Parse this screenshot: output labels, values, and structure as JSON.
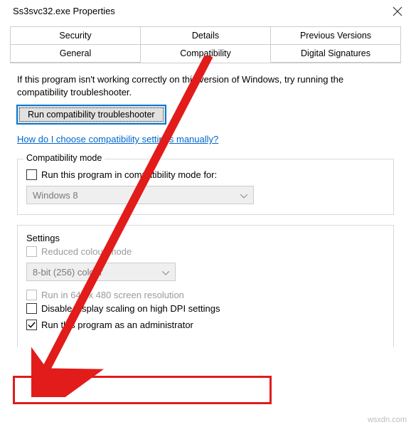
{
  "titlebar": {
    "title": "Ss3svc32.exe Properties"
  },
  "tabs": {
    "row1": [
      "Security",
      "Details",
      "Previous Versions"
    ],
    "row2": [
      "General",
      "Compatibility",
      "Digital Signatures"
    ],
    "active": "Compatibility"
  },
  "help": {
    "text": "If this program isn't working correctly on this version of Windows, try running the compatibility troubleshooter.",
    "button": "Run compatibility troubleshooter",
    "link": "How do I choose compatibility settings manually?"
  },
  "compat_mode": {
    "legend": "Compatibility mode",
    "checkbox_label": "Run this program in compatibility mode for:",
    "combo": "Windows 8"
  },
  "settings": {
    "legend": "Settings",
    "reduced_colour": "Reduced colour mode",
    "colour_combo": "8-bit (256) colour",
    "run_640": "Run in 640 x 480 screen resolution",
    "disable_dpi": "Disable display scaling on high DPI settings",
    "run_admin": "Run this program as an administrator"
  },
  "watermark": "wsxdn.com"
}
